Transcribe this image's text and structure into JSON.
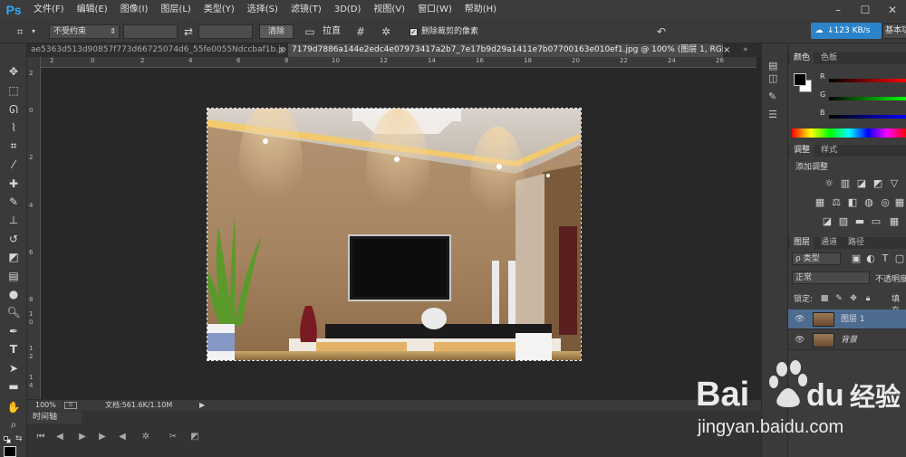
{
  "app": {
    "logo": "Ps"
  },
  "menu": [
    "文件(F)",
    "编辑(E)",
    "图像(I)",
    "图层(L)",
    "类型(Y)",
    "选择(S)",
    "滤镜(T)",
    "3D(D)",
    "视图(V)",
    "窗口(W)",
    "帮助(H)"
  ],
  "window_controls": [
    "–",
    "☐",
    "✕"
  ],
  "options": {
    "ratio_select": "不受约束",
    "clear_button": "清除",
    "straighten_label": "拉直",
    "delete_cropped_label": "删除裁剪的像素",
    "delete_cropped_checked": true,
    "net_speed": "↓123 KB/s",
    "workspace": "基本功能"
  },
  "tabs": [
    {
      "label": "ae5363d513d90857f773d66725074d6_55fe0055Ndccbaf1b.jpg",
      "active": false
    },
    {
      "label": "7179d7886a144e2edc4e07973417a2b7_7e17b9d29a1411e7b07700163e010ef1.jpg @ 100% (图层 1, RGB/8#) *",
      "active": true
    }
  ],
  "tab_close": "×",
  "ruler_top_numbers": [
    "2",
    "0",
    "2",
    "4",
    "6",
    "8",
    "10",
    "12",
    "14",
    "16",
    "18",
    "20",
    "22",
    "24",
    "26"
  ],
  "ruler_left_numbers": [
    "2",
    "0",
    "2",
    "4",
    "6",
    "8",
    "1\n0",
    "1\n2",
    "1\n4"
  ],
  "status": {
    "zoom": "100%",
    "doc_info": "文档:561.6K/1.10M"
  },
  "timeline": {
    "tab": "时间轴"
  },
  "panels": {
    "color_tabs": [
      "颜色",
      "色板"
    ],
    "rgb_labels": [
      "R",
      "G",
      "B"
    ],
    "adjust_tabs": [
      "调整",
      "样式"
    ],
    "add_adjustment": "添加调整",
    "layers_tabs": [
      "图层",
      "通道",
      "路径"
    ],
    "filter_kind": "ρ 类型",
    "blend_mode": "正常",
    "opacity_label": "不透明度",
    "lock_label": "锁定:",
    "fill_label": "填充",
    "layers": [
      {
        "name": "图层 1",
        "selected": true,
        "italic": false
      },
      {
        "name": "背景",
        "selected": false,
        "italic": true
      }
    ]
  },
  "watermark": {
    "brand_left": "Bai",
    "brand_right": "du",
    "brand_cn": "经验",
    "url": "jingyan.baidu.com"
  },
  "colors": {
    "accent": "#31a8ff",
    "selection": "#4d6b8f",
    "netspeed": "#2b84c9"
  }
}
